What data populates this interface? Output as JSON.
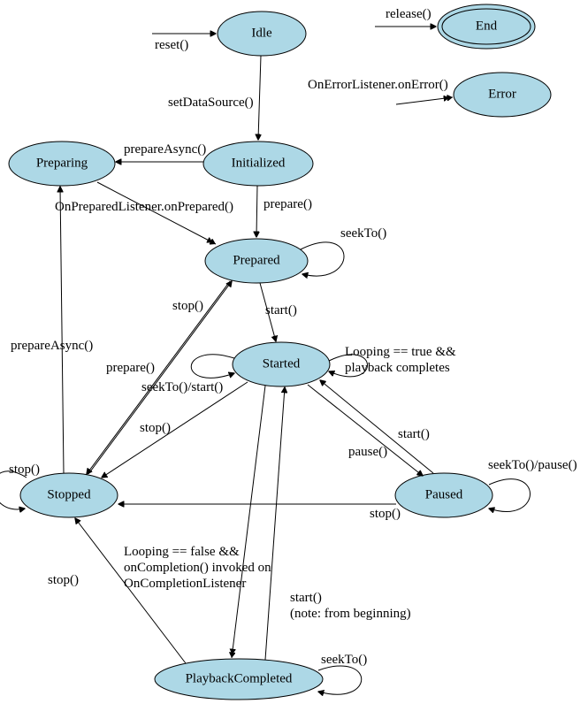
{
  "diagram_type": "state_machine",
  "subject": "Android MediaPlayer State Diagram",
  "states": {
    "idle": {
      "label": "Idle"
    },
    "initialized": {
      "label": "Initialized"
    },
    "preparing": {
      "label": "Preparing"
    },
    "prepared": {
      "label": "Prepared"
    },
    "started": {
      "label": "Started"
    },
    "stopped": {
      "label": "Stopped"
    },
    "paused": {
      "label": "Paused"
    },
    "playback_completed": {
      "label": "PlaybackCompleted"
    },
    "end": {
      "label": "End",
      "final": true
    },
    "error": {
      "label": "Error"
    }
  },
  "edges": {
    "reset_to_idle": {
      "label": "reset()"
    },
    "idle_to_initialized": {
      "label": "setDataSource()"
    },
    "initialized_to_preparing": {
      "label": "prepareAsync()"
    },
    "initialized_to_prepared": {
      "label": "prepare()"
    },
    "preparing_to_prepared": {
      "label": "OnPreparedListener.onPrepared()"
    },
    "prepared_self": {
      "label": "seekTo()"
    },
    "prepared_to_started": {
      "label": "start()"
    },
    "started_self_loop": {
      "label_line1": "Looping == true &&",
      "label_line2": "playback completes"
    },
    "started_self_seek": {
      "label": "seekTo()/start()"
    },
    "prepared_to_stopped": {
      "label": "stop()"
    },
    "started_to_stopped": {
      "label": "stop()"
    },
    "started_to_paused": {
      "label": "pause()"
    },
    "paused_to_started": {
      "label": "start()"
    },
    "paused_self": {
      "label": "seekTo()/pause()"
    },
    "paused_to_stopped": {
      "label": "stop()"
    },
    "stopped_self": {
      "label": "stop()"
    },
    "stopped_to_preparing": {
      "label": "prepareAsync()"
    },
    "stopped_to_prepared": {
      "label": "prepare()"
    },
    "started_to_pbc_l1": {
      "label": "Looping == false &&"
    },
    "started_to_pbc_l2": {
      "label": "onCompletion() invoked on"
    },
    "started_to_pbc_l3": {
      "label": "OnCompletionListener"
    },
    "pbc_to_started_l1": {
      "label": "start()"
    },
    "pbc_to_started_l2": {
      "label": "(note: from beginning)"
    },
    "pbc_self": {
      "label": "seekTo()"
    },
    "pbc_to_stopped": {
      "label": "stop()"
    },
    "release_to_end": {
      "label": "release()"
    },
    "onerror_to_error": {
      "label": "OnErrorListener.onError()"
    }
  }
}
